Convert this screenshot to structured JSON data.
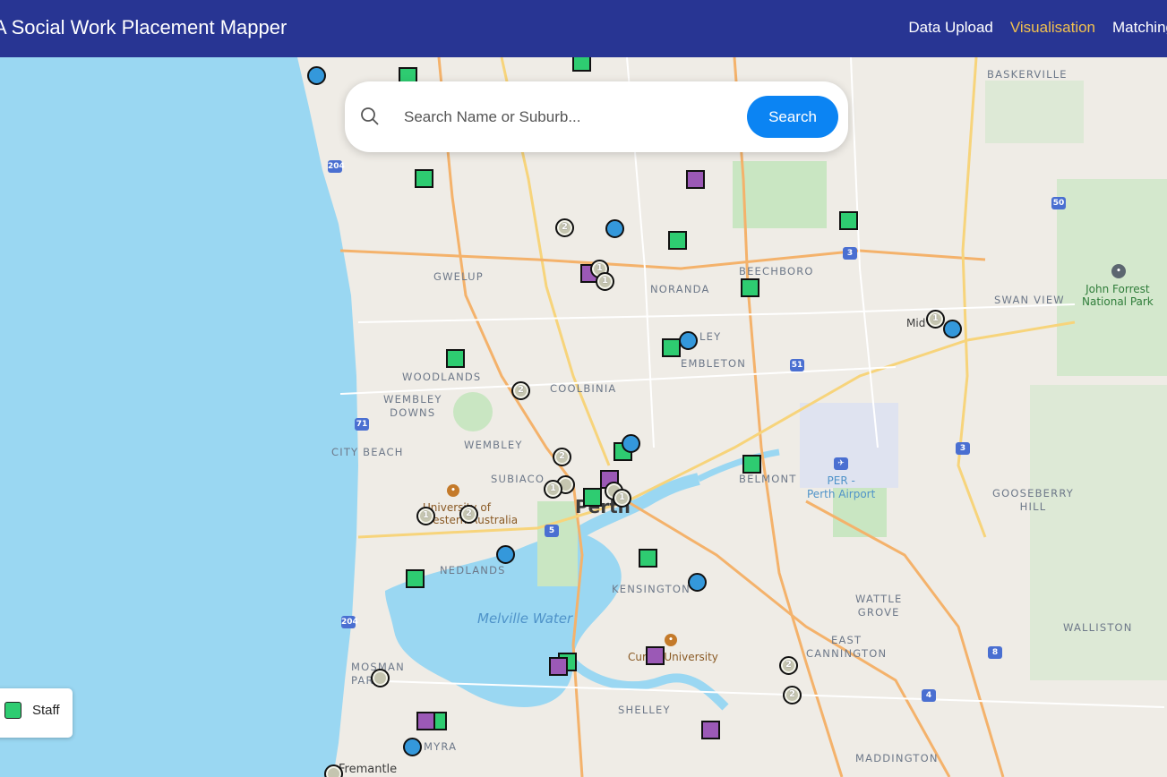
{
  "app": {
    "title": "A Social Work Placement Mapper"
  },
  "nav": {
    "items": [
      {
        "label": "Data Upload",
        "active": false
      },
      {
        "label": "Visualisation",
        "active": true
      },
      {
        "label": "Matching",
        "active": false
      }
    ]
  },
  "search": {
    "placeholder": "Search Name or Suburb...",
    "value": "",
    "button_label": "Search",
    "icon": "search-icon"
  },
  "legend": {
    "items": [
      {
        "label": "Staff",
        "color": "#2ecc71"
      }
    ]
  },
  "colors": {
    "navbar": "#283593",
    "active_nav": "#f2c14e",
    "staff": "#2ecc71",
    "placement": "#9b59b6",
    "student": "#3498db",
    "cluster": "#c5c5b0",
    "search_button": "#0b84f3"
  },
  "map": {
    "labels": {
      "baskerville": "BASKERVILLE",
      "gwelup": "GWELUP",
      "noranda": "NORANDA",
      "beechboro": "BEECHBORO",
      "swan_view": "SWAN VIEW",
      "john_forrest": "John Forrest\nNational Park",
      "woodlands": "WOODLANDS",
      "coolbinia": "COOLBINIA",
      "bayswater_frag": "LEY",
      "embleton": "EMBLETON",
      "wembley_downs": "WEMBLEY\nDOWNS",
      "city_beach": "CITY BEACH",
      "wembley": "WEMBLEY",
      "subiaco": "SUBIACO",
      "belmont": "BELMONT",
      "airport": "PER -\nPerth Airport",
      "gooseberry_hill": "GOOSEBERRY\nHILL",
      "uwa": "University of\nWestern Australia",
      "perth": "Perth",
      "nedlands": "NEDLANDS",
      "kensington": "KENSINGTON",
      "melville_water": "Melville Water",
      "wattle_grove": "WATTLE\nGROVE",
      "walliston": "WALLISTON",
      "east_cannington": "EAST\nCANNINGTON",
      "curtin": "Curtin University",
      "mosman_park": "MOSMAN\nPARK",
      "shelley": "SHELLEY",
      "palmyra": "MYRA",
      "fremantle": "Fremantle",
      "maddington": "MADDINGTON",
      "midland_frag": "Mid"
    },
    "shields": [
      "204",
      "50",
      "3",
      "51",
      "71",
      "5",
      "3",
      "204",
      "8",
      "4"
    ],
    "cluster_counts": [
      "2",
      "1",
      "1",
      "1",
      "2",
      "2",
      "1",
      "1",
      "1",
      "2",
      "2",
      "1",
      "2"
    ]
  }
}
